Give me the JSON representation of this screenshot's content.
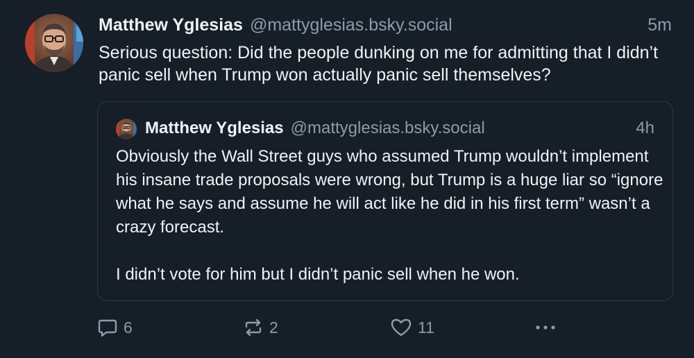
{
  "post": {
    "author_name": "Matthew Yglesias",
    "author_handle": "@mattyglesias.bsky.social",
    "time": "5m",
    "text": "Serious question: Did the people dunking on me for admitting that I didn’t panic sell when Trump won actually panic sell themselves?"
  },
  "quote": {
    "author_name": "Matthew Yglesias",
    "author_handle": "@mattyglesias.bsky.social",
    "time": "4h",
    "paragraph1": "Obviously the Wall Street guys who assumed Trump wouldn’t implement his insane trade proposals were wrong, but Trump is a huge liar so “ignore what he says and assume he will act like he did in his first term” wasn’t a crazy forecast.",
    "paragraph2": "I didn’t vote for him but I didn’t panic sell when he won."
  },
  "actions": {
    "reply_count": "6",
    "repost_count": "2",
    "like_count": "11",
    "icons": [
      "reply-icon",
      "repost-icon",
      "heart-icon",
      "more-icon"
    ]
  },
  "colors": {
    "background": "#161e27",
    "text": "#f1f3f5",
    "muted": "#8c9cae",
    "border": "#2e3a47"
  }
}
